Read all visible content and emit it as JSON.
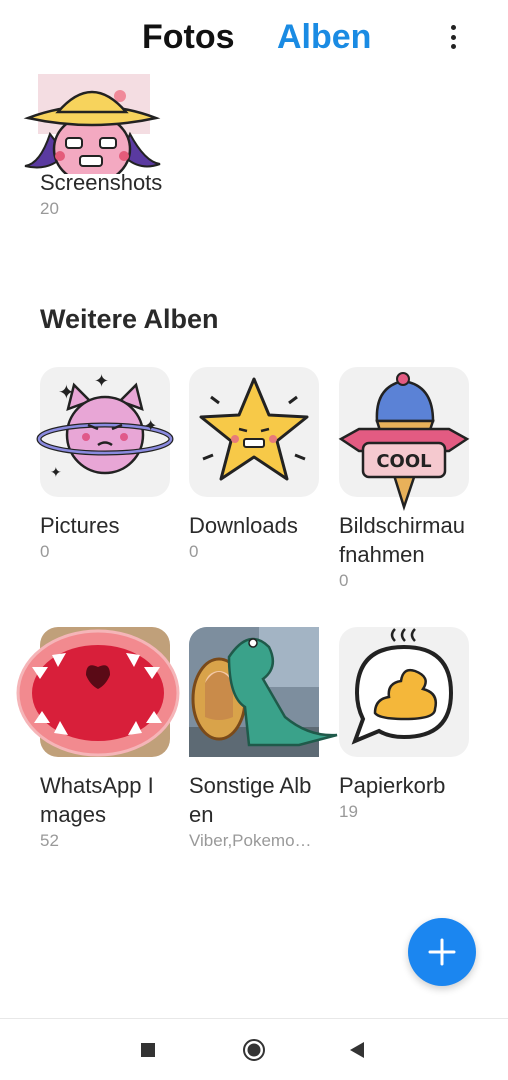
{
  "header": {
    "tab_photos": "Fotos",
    "tab_albums": "Alben",
    "active_tab": "Alben"
  },
  "top_album": {
    "name": "Screenshots",
    "count": "20"
  },
  "section_title": "Weitere Alben",
  "albums": [
    {
      "name": "Pictures",
      "count": "0",
      "icon": "planet-cat-sticker"
    },
    {
      "name": "Downloads",
      "count": "0",
      "icon": "star-sticker"
    },
    {
      "name": "Bildschirmaufnahmen",
      "count": "0",
      "icon": "ice-cream-cool-sticker"
    },
    {
      "name": "WhatsApp Images",
      "count": "52",
      "icon": "mouth-sticker"
    },
    {
      "name": "Sonstige Alben",
      "count": "Viber,Pokemo…",
      "icon": "dinosaur-photo"
    },
    {
      "name": "Papierkorb",
      "count": "19",
      "icon": "trash-poop-sticker"
    }
  ],
  "colors": {
    "accent": "#1a8be3",
    "fab": "#1b86f0"
  },
  "fab_icon": "plus-icon",
  "navbar": [
    "square-icon",
    "home-circle-icon",
    "back-triangle-icon"
  ]
}
